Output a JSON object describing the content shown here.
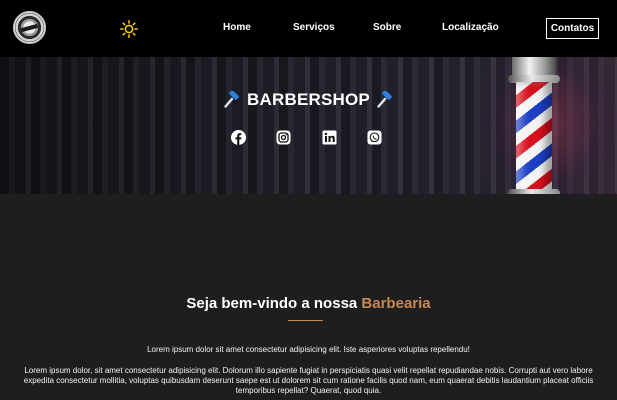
{
  "navbar": {
    "logo_icon": "barbershop-logo",
    "theme_icon": "sun-icon",
    "theme_icon_color": "#f5c518",
    "links": [
      "Home",
      "Serviços",
      "Sobre",
      "Localização"
    ],
    "cta_label": "Contatos"
  },
  "hero": {
    "title": "BARBERSHOP",
    "title_icon": "hammer-icon",
    "title_icon_color": "#2f7fe0",
    "background_image": "barber-pole-photo",
    "social_icons": [
      "facebook-icon",
      "instagram-icon",
      "linkedin-icon",
      "whatsapp-icon"
    ]
  },
  "welcome": {
    "heading_prefix": "Seja bem-vindo a nossa ",
    "heading_accent": "Barbearia",
    "accent_color": "#c8894f",
    "paragraph_1": "Lorem ipsum dolor sit amet consectetur adipisicing elit. Iste asperiores voluptas repellendu!",
    "paragraph_2": "Lorem ipsum dolor, sit amet consectetur adipisicing elit. Dolorum illo sapiente fugiat in perspiciatis quasi velit repellat repudiandae nobis. Corrupti aut vero labore expedita consectetur mollitia, voluptas quibusdam deserunt saepe est ut dolorem sit cum ratione facilis quod nam, eum quaerat debitis laudantium placeat officiis temporibus repellat? Quaerat, quod quia."
  },
  "colors": {
    "background": "#1f1e1e",
    "navbar": "#000000",
    "text": "#ffffff"
  }
}
